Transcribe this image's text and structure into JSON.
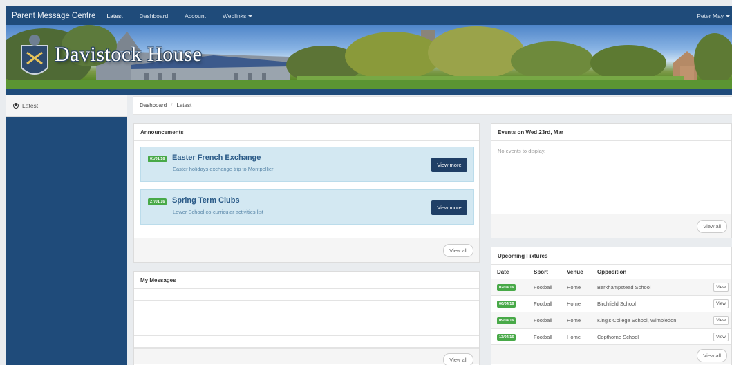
{
  "topnav": {
    "brand": "Parent Message Centre",
    "links": [
      "Latest",
      "Dashboard",
      "Account",
      "Weblinks"
    ],
    "user": "Peter May"
  },
  "banner": {
    "title": "Davistock House"
  },
  "sidebar": {
    "items": [
      {
        "label": "Latest"
      }
    ]
  },
  "breadcrumb": {
    "items": [
      "Dashboard",
      "Latest"
    ]
  },
  "announcements": {
    "title": "Announcements",
    "items": [
      {
        "date": "01/01/16",
        "title": "Easter French Exchange",
        "subtitle": "Easter holidays exchange trip to Montpellier",
        "button": "View more"
      },
      {
        "date": "27/01/16",
        "title": "Spring Term Clubs",
        "subtitle": "Lower School co-curricular activities list",
        "button": "View more"
      }
    ],
    "view_all": "View all"
  },
  "messages": {
    "title": "My Messages",
    "view_all": "View all"
  },
  "events": {
    "title": "Events on Wed 23rd, Mar",
    "empty": "No events to display.",
    "view_all": "View all"
  },
  "fixtures": {
    "title": "Upcoming Fixtures",
    "columns": [
      "Date",
      "Sport",
      "Venue",
      "Opposition"
    ],
    "rows": [
      {
        "date": "02/04/16",
        "sport": "Football",
        "venue": "Home",
        "opposition": "Berkhampstead School",
        "button": "View"
      },
      {
        "date": "06/04/16",
        "sport": "Football",
        "venue": "Home",
        "opposition": "Birchfield School",
        "button": "View"
      },
      {
        "date": "09/04/16",
        "sport": "Football",
        "venue": "Home",
        "opposition": "King's College School, Wimbledon",
        "button": "View"
      },
      {
        "date": "13/04/16",
        "sport": "Football",
        "venue": "Home",
        "opposition": "Copthorne School",
        "button": "View"
      }
    ],
    "view_all": "View all"
  },
  "colors": {
    "navy": "#1f4b7a",
    "badge_green": "#48a948",
    "button_dark": "#1f3f66",
    "announcement_bg": "#d3e8f2"
  }
}
